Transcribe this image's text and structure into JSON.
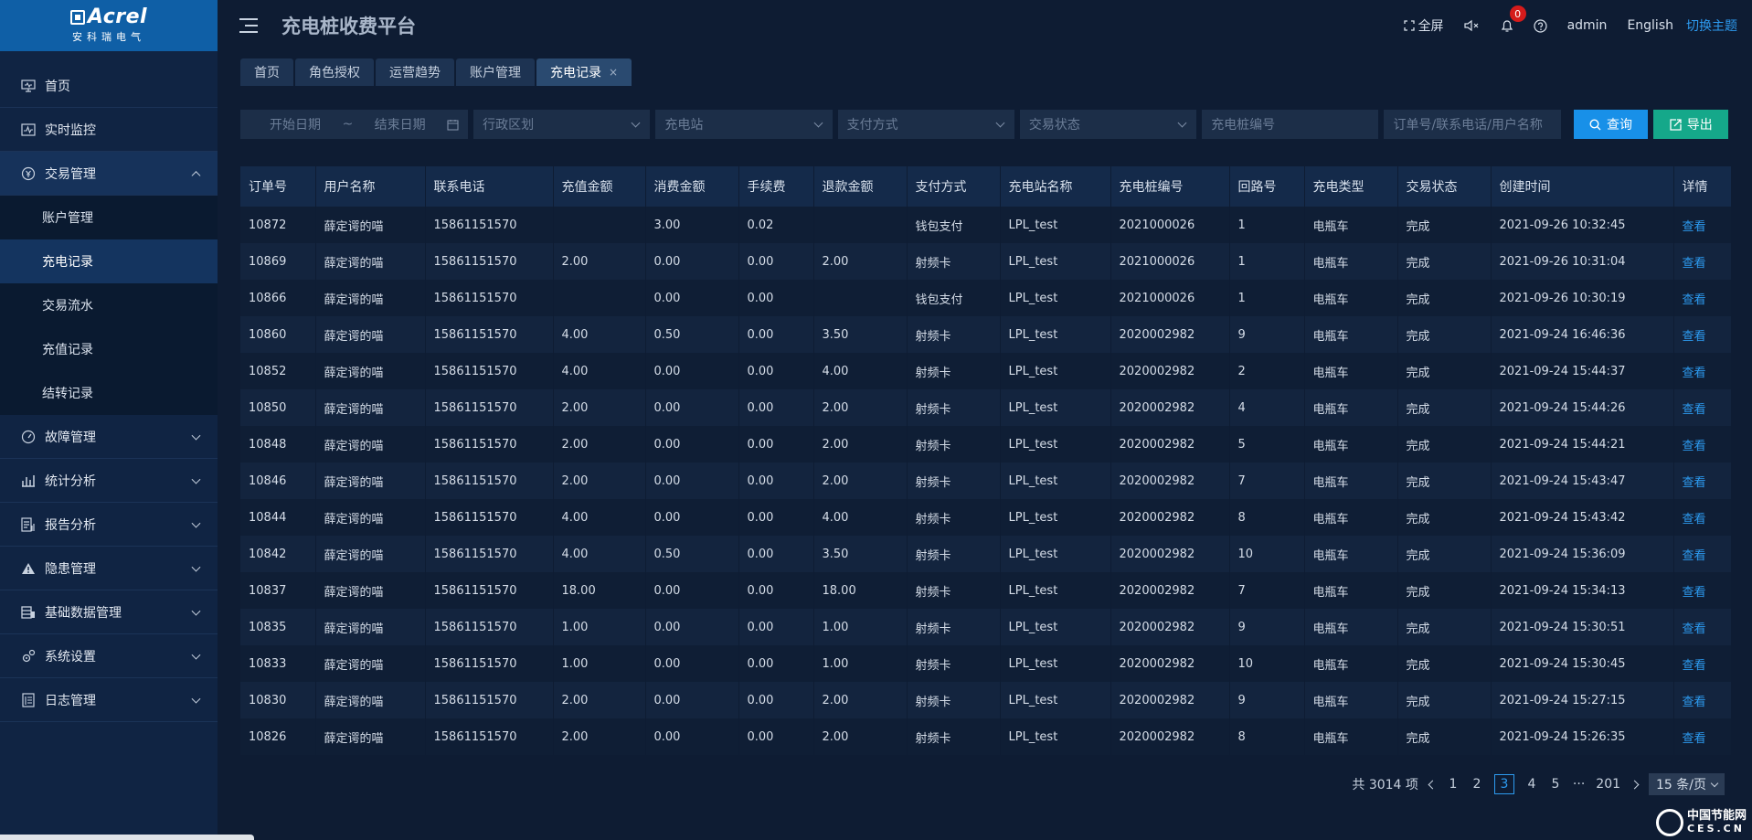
{
  "brand": {
    "name": "Acrel",
    "subtitle": "安科瑞电气"
  },
  "sidebar": {
    "items": [
      {
        "label": "首页",
        "icon": "monitor-icon"
      },
      {
        "label": "实时监控",
        "icon": "pulse-icon"
      },
      {
        "label": "交易管理",
        "icon": "money-icon",
        "open": true,
        "children": [
          {
            "label": "账户管理"
          },
          {
            "label": "充电记录",
            "active": true
          },
          {
            "label": "交易流水"
          },
          {
            "label": "充值记录"
          },
          {
            "label": "结转记录"
          }
        ]
      },
      {
        "label": "故障管理",
        "icon": "speedometer-icon"
      },
      {
        "label": "统计分析",
        "icon": "bar-chart-icon"
      },
      {
        "label": "报告分析",
        "icon": "report-icon"
      },
      {
        "label": "隐患管理",
        "icon": "warning-icon"
      },
      {
        "label": "基础数据管理",
        "icon": "database-icon"
      },
      {
        "label": "系统设置",
        "icon": "gear-icon"
      },
      {
        "label": "日志管理",
        "icon": "log-icon"
      }
    ]
  },
  "header": {
    "title": "充电桩收费平台",
    "fullscreen": "全屏",
    "notification_count": "0",
    "user": "admin",
    "language": "English",
    "switch_theme": "切换主题"
  },
  "tabs": [
    {
      "label": "首页"
    },
    {
      "label": "角色授权"
    },
    {
      "label": "运营趋势"
    },
    {
      "label": "账户管理"
    },
    {
      "label": "充电记录",
      "active": true,
      "closable": true
    }
  ],
  "filters": {
    "start_date": "开始日期",
    "date_sep": "~",
    "end_date": "结束日期",
    "region": "行政区划",
    "station": "充电站",
    "payment": "支付方式",
    "status": "交易状态",
    "pile_no": "充电桩编号",
    "keyword": "订单号/联系电话/用户名称",
    "query_label": "查询",
    "export_label": "导出"
  },
  "table": {
    "columns": [
      "订单号",
      "用户名称",
      "联系电话",
      "充值金额",
      "消费金额",
      "手续费",
      "退款金额",
      "支付方式",
      "充电站名称",
      "充电桩编号",
      "回路号",
      "充电类型",
      "交易状态",
      "创建时间",
      "详情"
    ],
    "rows": [
      [
        "10872",
        "薛定谔的喵",
        "15861151570",
        "",
        "3.00",
        "0.02",
        "",
        "钱包支付",
        "LPL_test",
        "2021000026",
        "1",
        "电瓶车",
        "完成",
        "2021-09-26 10:32:45",
        "查看"
      ],
      [
        "10869",
        "薛定谔的喵",
        "15861151570",
        "2.00",
        "0.00",
        "0.00",
        "2.00",
        "射频卡",
        "LPL_test",
        "2021000026",
        "1",
        "电瓶车",
        "完成",
        "2021-09-26 10:31:04",
        "查看"
      ],
      [
        "10866",
        "薛定谔的喵",
        "15861151570",
        "",
        "0.00",
        "0.00",
        "",
        "钱包支付",
        "LPL_test",
        "2021000026",
        "1",
        "电瓶车",
        "完成",
        "2021-09-26 10:30:19",
        "查看"
      ],
      [
        "10860",
        "薛定谔的喵",
        "15861151570",
        "4.00",
        "0.50",
        "0.00",
        "3.50",
        "射频卡",
        "LPL_test",
        "2020002982",
        "9",
        "电瓶车",
        "完成",
        "2021-09-24 16:46:36",
        "查看"
      ],
      [
        "10852",
        "薛定谔的喵",
        "15861151570",
        "4.00",
        "0.00",
        "0.00",
        "4.00",
        "射频卡",
        "LPL_test",
        "2020002982",
        "2",
        "电瓶车",
        "完成",
        "2021-09-24 15:44:37",
        "查看"
      ],
      [
        "10850",
        "薛定谔的喵",
        "15861151570",
        "2.00",
        "0.00",
        "0.00",
        "2.00",
        "射频卡",
        "LPL_test",
        "2020002982",
        "4",
        "电瓶车",
        "完成",
        "2021-09-24 15:44:26",
        "查看"
      ],
      [
        "10848",
        "薛定谔的喵",
        "15861151570",
        "2.00",
        "0.00",
        "0.00",
        "2.00",
        "射频卡",
        "LPL_test",
        "2020002982",
        "5",
        "电瓶车",
        "完成",
        "2021-09-24 15:44:21",
        "查看"
      ],
      [
        "10846",
        "薛定谔的喵",
        "15861151570",
        "2.00",
        "0.00",
        "0.00",
        "2.00",
        "射频卡",
        "LPL_test",
        "2020002982",
        "7",
        "电瓶车",
        "完成",
        "2021-09-24 15:43:47",
        "查看"
      ],
      [
        "10844",
        "薛定谔的喵",
        "15861151570",
        "4.00",
        "0.00",
        "0.00",
        "4.00",
        "射频卡",
        "LPL_test",
        "2020002982",
        "8",
        "电瓶车",
        "完成",
        "2021-09-24 15:43:42",
        "查看"
      ],
      [
        "10842",
        "薛定谔的喵",
        "15861151570",
        "4.00",
        "0.50",
        "0.00",
        "3.50",
        "射频卡",
        "LPL_test",
        "2020002982",
        "10",
        "电瓶车",
        "完成",
        "2021-09-24 15:36:09",
        "查看"
      ],
      [
        "10837",
        "薛定谔的喵",
        "15861151570",
        "18.00",
        "0.00",
        "0.00",
        "18.00",
        "射频卡",
        "LPL_test",
        "2020002982",
        "7",
        "电瓶车",
        "完成",
        "2021-09-24 15:34:13",
        "查看"
      ],
      [
        "10835",
        "薛定谔的喵",
        "15861151570",
        "1.00",
        "0.00",
        "0.00",
        "1.00",
        "射频卡",
        "LPL_test",
        "2020002982",
        "9",
        "电瓶车",
        "完成",
        "2021-09-24 15:30:51",
        "查看"
      ],
      [
        "10833",
        "薛定谔的喵",
        "15861151570",
        "1.00",
        "0.00",
        "0.00",
        "1.00",
        "射频卡",
        "LPL_test",
        "2020002982",
        "10",
        "电瓶车",
        "完成",
        "2021-09-24 15:30:45",
        "查看"
      ],
      [
        "10830",
        "薛定谔的喵",
        "15861151570",
        "2.00",
        "0.00",
        "0.00",
        "2.00",
        "射频卡",
        "LPL_test",
        "2020002982",
        "9",
        "电瓶车",
        "完成",
        "2021-09-24 15:27:15",
        "查看"
      ],
      [
        "10826",
        "薛定谔的喵",
        "15861151570",
        "2.00",
        "0.00",
        "0.00",
        "2.00",
        "射频卡",
        "LPL_test",
        "2020002982",
        "8",
        "电瓶车",
        "完成",
        "2021-09-24 15:26:35",
        "查看"
      ]
    ]
  },
  "pagination": {
    "total": "共 3014 项",
    "pages": [
      "1",
      "2",
      "3",
      "4",
      "5"
    ],
    "current": "3",
    "ellipsis": "···",
    "last": "201",
    "page_size": "15 条/页"
  },
  "watermark": {
    "line1": "中国节能网",
    "line2": "CES.CN"
  },
  "colors": {
    "accent": "#1890e8",
    "export": "#15a88a",
    "link": "#2d9bf0",
    "badge": "#d51b1b",
    "logo_bg": "#0f5fa6"
  }
}
